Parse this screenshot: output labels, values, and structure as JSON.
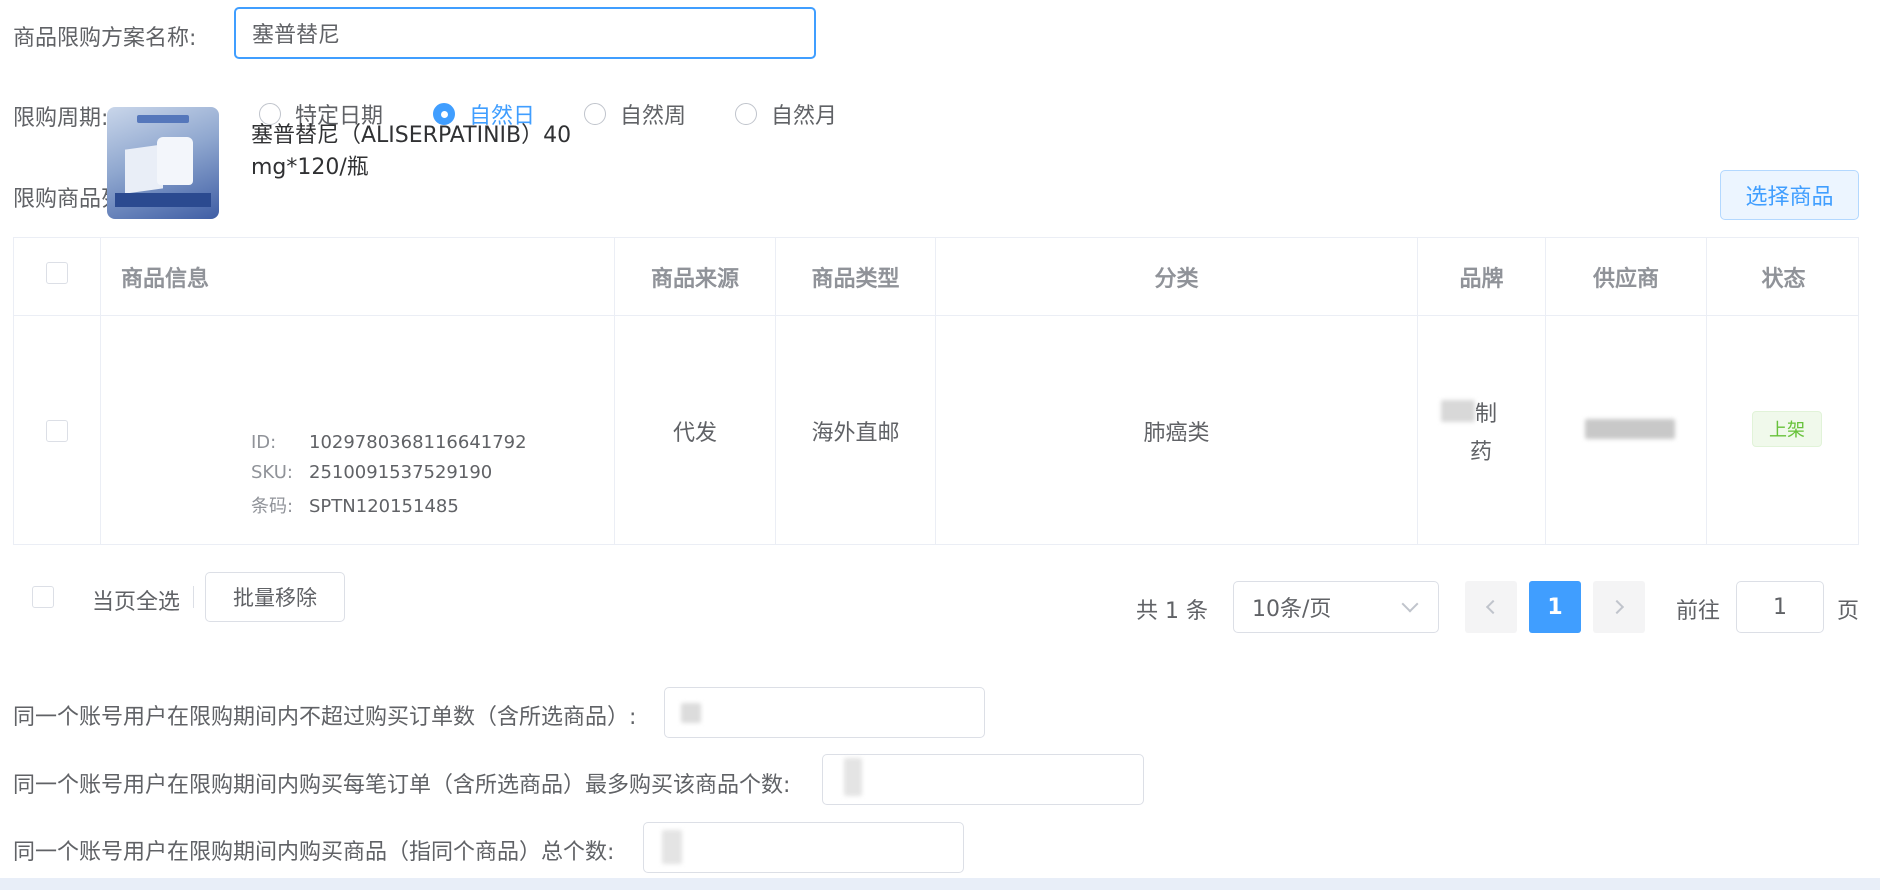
{
  "form": {
    "plan_name_label": "商品限购方案名称:",
    "plan_name_value": "塞普替尼",
    "period_label": "限购周期:",
    "period_options": [
      {
        "label": "特定日期",
        "checked": false
      },
      {
        "label": "自然日",
        "checked": true
      },
      {
        "label": "自然周",
        "checked": false
      },
      {
        "label": "自然月",
        "checked": false
      }
    ]
  },
  "product_list": {
    "title": "限购商品列表",
    "select_button": "选择商品",
    "columns": [
      "商品信息",
      "商品来源",
      "商品类型",
      "分类",
      "品牌",
      "供应商",
      "状态"
    ],
    "rows": [
      {
        "name": "塞普替尼（ALISERPATINIB）40 mg*120/瓶",
        "id_label": "ID:",
        "id": "1029780368116641792",
        "sku_label": "SKU:",
        "sku": "2510091537529190",
        "barcode_label": "条码:",
        "barcode": "SPTN120151485",
        "source": "代发",
        "type": "海外直邮",
        "category": "肺癌类",
        "brand_line1": "制",
        "brand_line2": "药",
        "status": "上架"
      }
    ]
  },
  "footer": {
    "select_page_all": "当页全选",
    "batch_remove": "批量移除",
    "total": "共 1 条",
    "page_size": "10条/页",
    "current_page": "1",
    "goto_label": "前往",
    "goto_value": "1",
    "page_suffix": "页"
  },
  "limits": {
    "max_orders_label": "同一个账号用户在限购期间内不超过购买订单数（含所选商品）:",
    "max_per_order_label": "同一个账号用户在限购期间内购买每笔订单（含所选商品）最多购买该商品个数:",
    "max_total_label": "同一个账号用户在限购期间内购买商品（指同个商品）总个数:"
  },
  "colors": {
    "primary": "#409eff",
    "success": "#67c23a",
    "text": "#606266",
    "header_text": "#909399",
    "border": "#ebeef5"
  }
}
